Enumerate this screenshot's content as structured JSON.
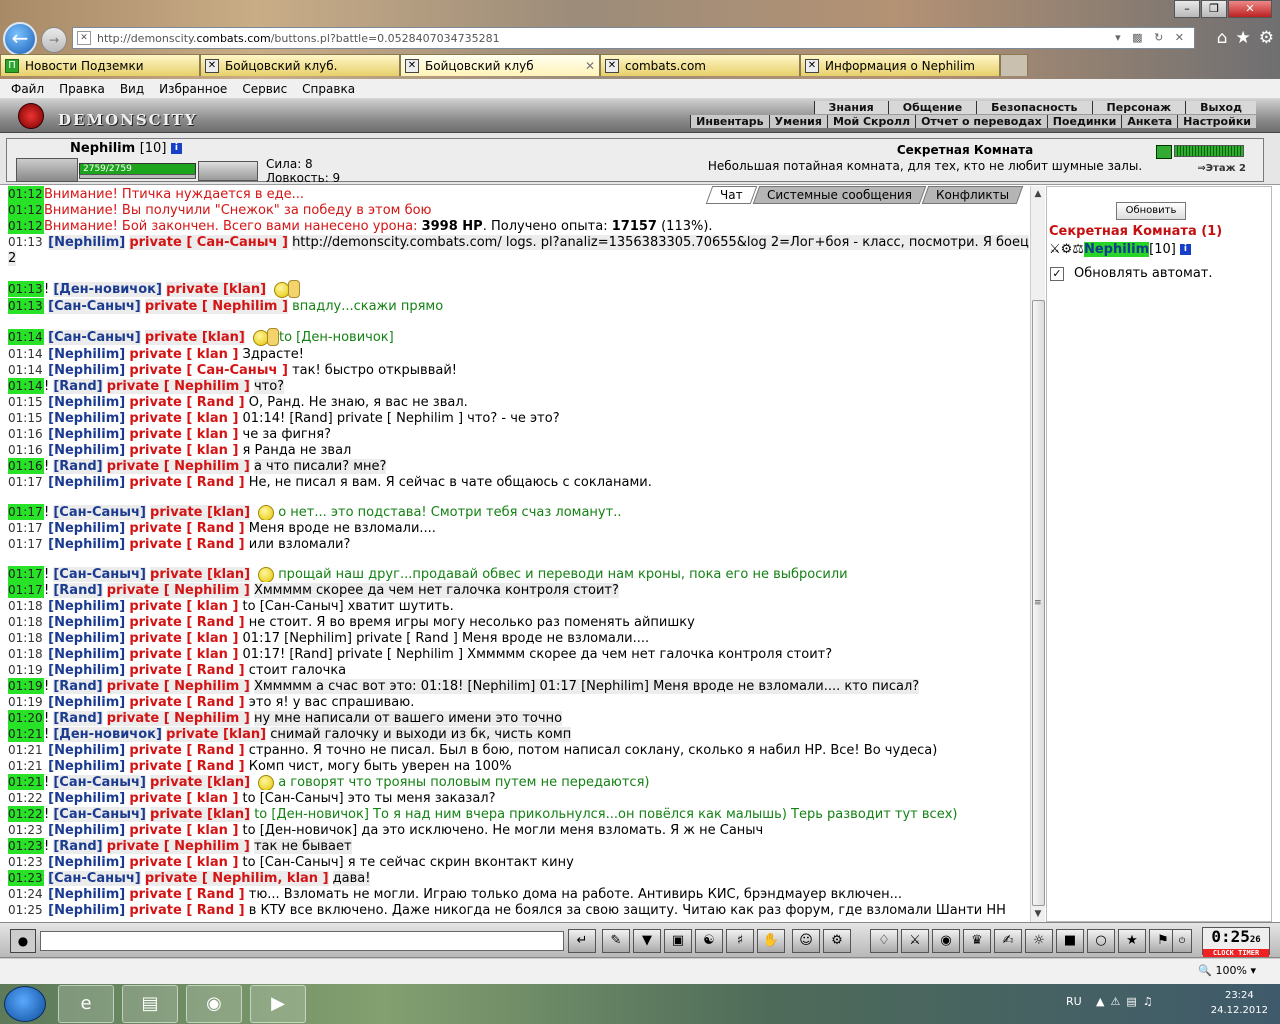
{
  "browser": {
    "url_prefix": "http://demonscity.",
    "url_host": "combats.com",
    "url_suffix": "/buttons.pl?battle=0.0528407034735281",
    "tabs": [
      {
        "label": "Новости Подземки"
      },
      {
        "label": "Бойцовский клуб."
      },
      {
        "label": "Бойцовский клуб"
      },
      {
        "label": "combats.com"
      },
      {
        "label": "Информация о Nephilim"
      }
    ],
    "menu": [
      "Файл",
      "Правка",
      "Вид",
      "Избранное",
      "Сервис",
      "Справка"
    ],
    "zoom": "100%"
  },
  "game": {
    "logo": "DEMONSCITY",
    "nav_top": [
      "Знания",
      "Общение",
      "Безопасность",
      "Персонаж",
      "Выход"
    ],
    "nav_bottom": [
      "Инвентарь",
      "Умения",
      "Мой Скролл",
      "Отчет о переводах",
      "Поединки",
      "Анкета",
      "Настройки"
    ],
    "player": {
      "name": "Nephilim",
      "level": "[10]",
      "hp": "2759/2759",
      "stat1": "Сила: 8",
      "stat2": "Ловкость: 9"
    },
    "room": {
      "title": "Секретная Комната",
      "desc": "Небольшая потайная комната, для тех, кто не любит шумные залы.",
      "floor": "Этаж 2"
    }
  },
  "chat": {
    "tabs": [
      "Чат",
      "Системные сообщения",
      "Конфликты"
    ],
    "lines": [
      {
        "ts": "01:12",
        "t": "Внимание! Птичка нуждается в еде..."
      },
      {
        "ts": "01:12",
        "t": "Внимание! Вы получили \"Снежок\" за победу в этом бою"
      },
      {
        "ts": "01:12",
        "a": "Внимание! Бой закончен. Всего вами нанесено урона: ",
        "b": "3998 HP",
        "c": ". Получено опыта: ",
        "d": "17157",
        "e": " (113%)."
      },
      {
        "ts": "01:13",
        "n": "[Nephilim]",
        "p": "private [ Сан-Саныч ]",
        "m": " http://demonscity.combats.com/ logs. pl?analiz=1356383305.70655&log 2=Лог+боя - класс, посмотри. Я боец 2"
      },
      {
        "ts": "01:13",
        "n": "[Ден-новичок]",
        "p": "private [klan]",
        "m": ""
      },
      {
        "ts": "01:13",
        "n": "[Сан-Саныч]",
        "p": "private [ Nephilim ]",
        "m": "впадлу...скажи прямо"
      },
      {
        "ts": "01:14",
        "n": "[Сан-Саныч]",
        "p": "private [klan]",
        "m": "to [Ден-новичок]"
      },
      {
        "ts": "01:14",
        "n": "[Nephilim]",
        "p": "private [ klan ]",
        "m": "Здрасте!"
      },
      {
        "ts": "01:14",
        "n": "[Nephilim]",
        "p": "private [ Сан-Саныч ]",
        "m": "так! быстро открыввай!"
      },
      {
        "ts": "01:14",
        "n": "[Rand]",
        "p": "private [ Nephilim ]",
        "m": "что?"
      },
      {
        "ts": "01:15",
        "n": "[Nephilim]",
        "p": "private [ Rand ]",
        "m": "О, Рaнд. Не знаю, я вас не звал."
      },
      {
        "ts": "01:15",
        "n": "[Nephilim]",
        "p": "private [ klan ]",
        "m": "01:14! [Rand] private [ Nephilim ] что? - че это?"
      },
      {
        "ts": "01:16",
        "n": "[Nephilim]",
        "p": "private [ klan ]",
        "m": "че за фигня?"
      },
      {
        "ts": "01:16",
        "n": "[Nephilim]",
        "p": "private [ klan ]",
        "m": "я Ранда не звал"
      },
      {
        "ts": "01:16",
        "n": "[Rand]",
        "p": "private [ Nephilim ]",
        "m": "а что писали? мне?"
      },
      {
        "ts": "01:17",
        "n": "[Nephilim]",
        "p": "private [ Rand ]",
        "m": "Не, не писал я вам. Я сейчас в чате общаюсь с сокланами."
      },
      {
        "ts": "01:17",
        "n": "[Сан-Саныч]",
        "p": "private [klan]",
        "m": "о нет... это подстава! Смотри тебя счаз ломанут.."
      },
      {
        "ts": "01:17",
        "n": "[Nephilim]",
        "p": "private [ Rand ]",
        "m": "Меня вроде не взломали...."
      },
      {
        "ts": "01:17",
        "n": "[Nephilim]",
        "p": "private [ Rand ]",
        "m": "или взломали?"
      },
      {
        "ts": "01:17",
        "n": "[Сан-Саныч]",
        "p": "private [klan]",
        "m": "прощай наш друг...продавай обвес и переводи нам кроны, пока его не выбросили"
      },
      {
        "ts": "01:17",
        "n": "[Rand]",
        "p": "private [ Nephilim ]",
        "m": "Хммммм скорее да чем нет галочка контроля стоит?"
      },
      {
        "ts": "01:18",
        "n": "[Nephilim]",
        "p": "private [ klan ]",
        "m": "to [Сан-Саныч] хватит шутить."
      },
      {
        "ts": "01:18",
        "n": "[Nephilim]",
        "p": "private [ Rand ]",
        "m": "не стоит. Я во время игры могу несолько раз поменять айпишку"
      },
      {
        "ts": "01:18",
        "n": "[Nephilim]",
        "p": "private [ klan ]",
        "m": "01:17 [Nephilim] private [ Rand ] Меня вроде не взломали...."
      },
      {
        "ts": "01:18",
        "n": "[Nephilim]",
        "p": "private [ klan ]",
        "m": "01:17! [Rand] private [ Nephilim ] Хммммм скорее да чем нет галочка контроля стоит?"
      },
      {
        "ts": "01:19",
        "n": "[Nephilim]",
        "p": "private [ Rand ]",
        "m": "стоит галочка"
      },
      {
        "ts": "01:19",
        "n": "[Rand]",
        "p": "private [ Nephilim ]",
        "m": "Хммммм а счас вот это: 01:18! [Nephilim] 01:17 [Nephilim] Меня вроде не взломали.... кто писал?"
      },
      {
        "ts": "01:19",
        "n": "[Nephilim]",
        "p": "private [ Rand ]",
        "m": "это я! у вас спрашиваю."
      },
      {
        "ts": "01:20",
        "n": "[Rand]",
        "p": "private [ Nephilim ]",
        "m": "ну мне написали от вашего имени это точно"
      },
      {
        "ts": "01:21",
        "n": "[Ден-новичок]",
        "p": "private [klan]",
        "m": "снимай галочку и выходи из бк, чисть комп"
      },
      {
        "ts": "01:21",
        "n": "[Nephilim]",
        "p": "private [ Rand ]",
        "m": "странно. Я точно не писал. Был в бою, потом написал соклану, сколько я набил НР. Все! Во чудеса)"
      },
      {
        "ts": "01:21",
        "n": "[Nephilim]",
        "p": "private [ Rand ]",
        "m": "Комп чист, могу быть уверен на 100%"
      },
      {
        "ts": "01:21",
        "n": "[Сан-Саныч]",
        "p": "private [klan]",
        "m": "а говорят что трояны половым путем не передаются)"
      },
      {
        "ts": "01:22",
        "n": "[Nephilim]",
        "p": "private [ klan ]",
        "m": "to [Сан-Саныч] это ты меня заказал?"
      },
      {
        "ts": "01:22",
        "n": "[Сан-Саныч]",
        "p": "private [klan]",
        "m": "to [Ден-новичок] То я над ним вчера прикольнулся...он повёлся как малышь) Терь разводит тут всех)"
      },
      {
        "ts": "01:23",
        "n": "[Nephilim]",
        "p": "private [ klan ]",
        "m": "to [Ден-новичок] да это исключено. Не могли меня взломать. Я ж не Саныч"
      },
      {
        "ts": "01:23",
        "n": "[Rand]",
        "p": "private [ Nephilim ]",
        "m": "так не бывает"
      },
      {
        "ts": "01:23",
        "n": "[Nephilim]",
        "p": "private [ klan ]",
        "m": "to [Сан-Саныч] я те сейчас скрин вконтакт кину"
      },
      {
        "ts": "01:23",
        "n": "[Сан-Саныч]",
        "p": "private [ Nephilim, klan ]",
        "m": "дава!"
      },
      {
        "ts": "01:24",
        "n": "[Nephilim]",
        "p": "private [ Rand ]",
        "m": "тю... Взломать не могли. Играю только дома на работе. Антивирь КИС, брэндмауер включен..."
      },
      {
        "ts": "01:25",
        "n": "[Nephilim]",
        "p": "private [ Rand ]",
        "m": "в КТУ все включено. Даже никогда не боялся за свою защиту. Читаю как раз форум, где взломали Шанти НН"
      }
    ]
  },
  "right_panel": {
    "refresh": "Обновить",
    "room_title": "Секретная Комната (1)",
    "user": "Nephilim",
    "user_level": "[10]",
    "auto_refresh": "Обновлять автомат."
  },
  "clock": {
    "time": "0:25",
    "sec": "26",
    "l1": "CLOCK",
    "l2": "TIMER"
  },
  "taskbar": {
    "lang": "RU",
    "time": "23:24",
    "date": "24.12.2012"
  }
}
